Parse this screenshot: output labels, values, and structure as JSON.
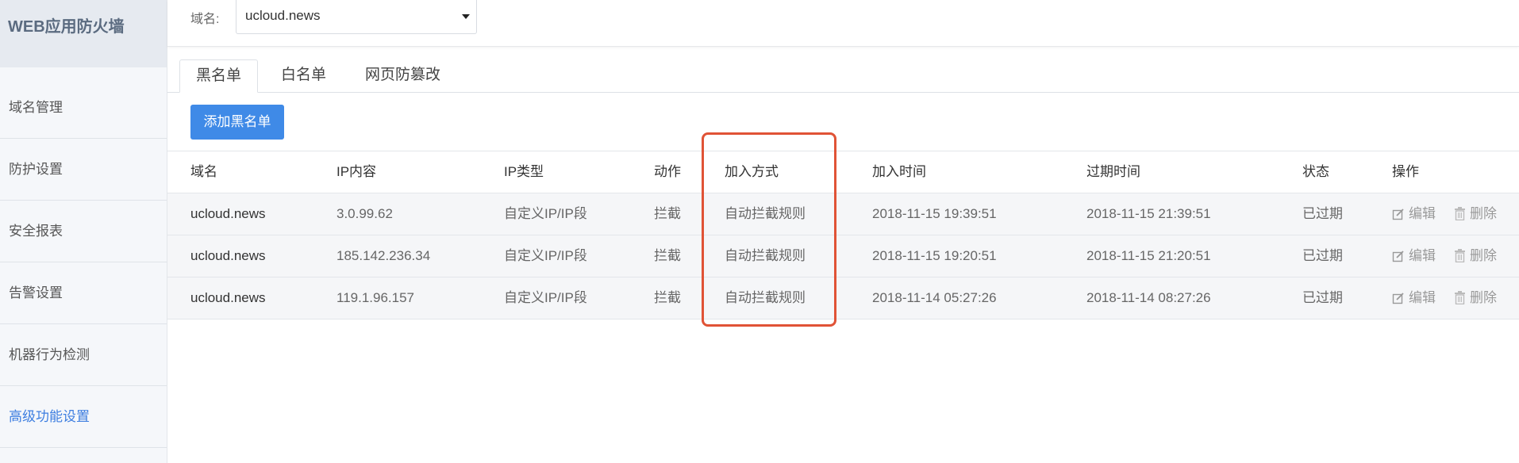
{
  "app": {
    "title": "WEB应用防火墙"
  },
  "sidebar": {
    "items": [
      {
        "label": "域名管理"
      },
      {
        "label": "防护设置"
      },
      {
        "label": "安全报表"
      },
      {
        "label": "告警设置"
      },
      {
        "label": "机器行为检测"
      },
      {
        "label": "高级功能设置",
        "active": true
      }
    ]
  },
  "topbar": {
    "domain_label": "域名:",
    "domain_value": "ucloud.news"
  },
  "tabs": [
    {
      "label": "黑名单",
      "active": true
    },
    {
      "label": "白名单"
    },
    {
      "label": "网页防篡改"
    }
  ],
  "add_button": "添加黑名单",
  "table": {
    "headers": [
      "域名",
      "IP内容",
      "IP类型",
      "动作",
      "加入方式",
      "加入时间",
      "过期时间",
      "状态",
      "操作"
    ],
    "rows": [
      [
        "ucloud.news",
        "3.0.99.62",
        "自定义IP/IP段",
        "拦截",
        "自动拦截规则",
        "2018-11-15 19:39:51",
        "2018-11-15 21:39:51",
        "已过期"
      ],
      [
        "ucloud.news",
        "185.142.236.34",
        "自定义IP/IP段",
        "拦截",
        "自动拦截规则",
        "2018-11-15 19:20:51",
        "2018-11-15 21:20:51",
        "已过期"
      ],
      [
        "ucloud.news",
        "119.1.96.157",
        "自定义IP/IP段",
        "拦截",
        "自动拦截规则",
        "2018-11-14 05:27:26",
        "2018-11-14 08:27:26",
        "已过期"
      ]
    ],
    "actions": {
      "edit": "编辑",
      "delete": "删除"
    }
  },
  "highlight_color": "#e05336",
  "accent_color": "#3f8ae7"
}
